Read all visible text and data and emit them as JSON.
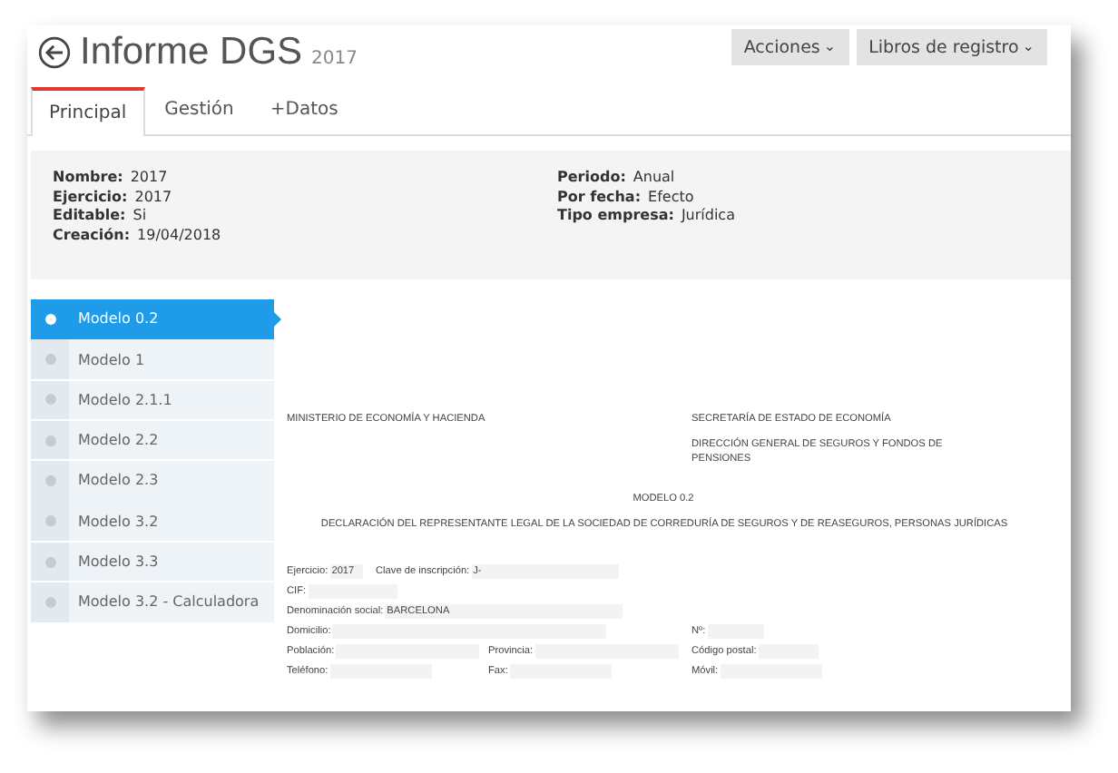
{
  "header": {
    "title": "Informe DGS",
    "year": "2017",
    "buttons": [
      {
        "label": "Acciones",
        "caret": "⌄"
      },
      {
        "label": "Libros de registro",
        "caret": "⌄"
      }
    ]
  },
  "tabs": [
    {
      "label": "Principal",
      "selected": true
    },
    {
      "label": "Gestión",
      "selected": false
    },
    {
      "label": "+Datos",
      "selected": false
    }
  ],
  "info": {
    "left": [
      {
        "label": "Nombre:",
        "value": "2017"
      },
      {
        "label": "Ejercicio:",
        "value": "2017"
      },
      {
        "label": "Editable:",
        "value": "Si"
      },
      {
        "label": "Creación:",
        "value": "19/04/2018"
      }
    ],
    "right": [
      {
        "label": "Periodo:",
        "value": "Anual"
      },
      {
        "label": "Por fecha:",
        "value": "Efecto"
      },
      {
        "label": "Tipo empresa:",
        "value": "Jurídica"
      }
    ]
  },
  "sidebar": {
    "items": [
      {
        "label": "Modelo 0.2",
        "selected": true
      },
      {
        "label": "Modelo 1",
        "selected": false
      },
      {
        "label": "Modelo 2.1.1",
        "selected": false
      },
      {
        "label": "Modelo 2.2",
        "selected": false
      },
      {
        "label": "Modelo 2.3",
        "selected": false
      },
      {
        "label": "Modelo 3.2",
        "selected": false
      },
      {
        "label": "Modelo 3.3",
        "selected": false
      },
      {
        "label": "Modelo 3.2 - Calculadora",
        "selected": false
      }
    ]
  },
  "document": {
    "ministry": "MINISTERIO DE ECONOMÍA Y HACIENDA",
    "secretariat": "SECRETARÍA DE ESTADO DE ECONOMÍA",
    "directorate": "DIRECCIÓN GENERAL DE SEGUROS Y FONDOS DE PENSIONES",
    "model": "MODELO 0.2",
    "heading": "DECLARACIÓN DEL REPRESENTANTE LEGAL DE LA SOCIEDAD DE CORREDURÍA DE SEGUROS Y DE REASEGUROS, PERSONAS JURÍDICAS",
    "rows": [
      [
        {
          "label": "Ejercicio:",
          "value": "2017"
        },
        {
          "label": "Clave de inscripción:",
          "value": "J-"
        }
      ],
      [
        {
          "label": "CIF:"
        }
      ],
      [
        {
          "label": "Denominación social:",
          "value": "BARCELONA"
        }
      ],
      [
        {
          "label": "Domicilio:"
        },
        {},
        {
          "label": "Nº:"
        }
      ],
      [
        {
          "label": "Población:"
        },
        {
          "label": "Provincia:"
        },
        {
          "label": "Código postal:"
        }
      ],
      [
        {
          "label": "Teléfono:"
        },
        {
          "label": "Fax:"
        },
        {
          "label": "Móvil:"
        }
      ]
    ]
  }
}
